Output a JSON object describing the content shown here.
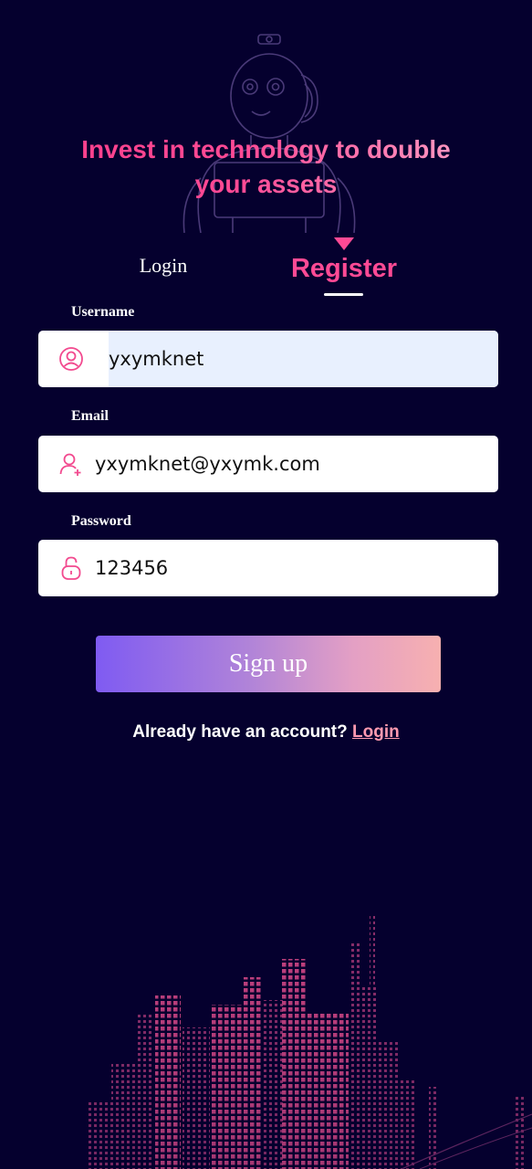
{
  "colors": {
    "background": "#05002e",
    "accent": "#ff4a95",
    "link": "#ff9ab0",
    "button_gradient_start": "#7f5bf2",
    "button_gradient_end": "#f7b0b0",
    "autofill": "#e8f0fe"
  },
  "hero": {
    "headline_line1": "Invest in technology to double",
    "headline_line2": "your assets",
    "illustration": "robot-line-art"
  },
  "tabs": [
    {
      "label": "Login",
      "active": false
    },
    {
      "label": "Register",
      "active": true
    }
  ],
  "form": {
    "username": {
      "label": "Username",
      "value": "yxymknet",
      "icon": "user-circle-icon"
    },
    "email": {
      "label": "Email",
      "value": "yxymknet@yxymk.com",
      "icon": "user-add-icon"
    },
    "password": {
      "label": "Password",
      "value": "123456",
      "icon": "lock-icon"
    },
    "submit_label": "Sign up"
  },
  "footer": {
    "prompt": "Already have an account?",
    "link": "Login"
  },
  "background_art": "city-skyline-dots"
}
